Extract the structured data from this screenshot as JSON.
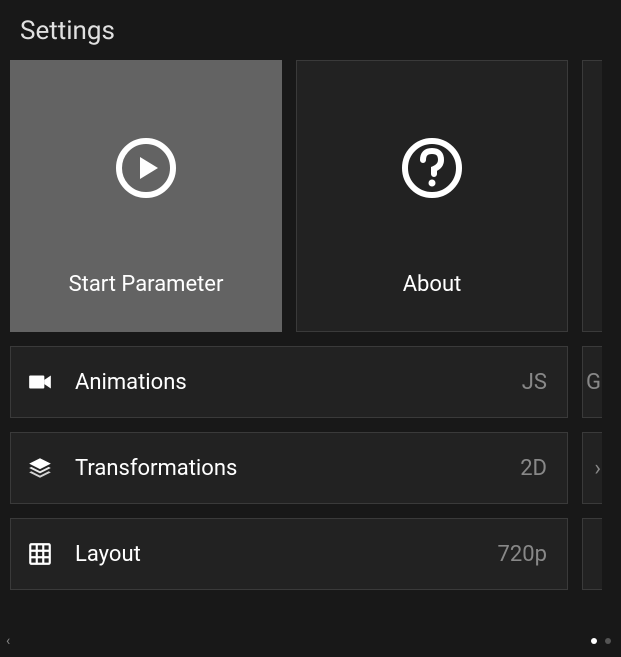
{
  "header": {
    "title": "Settings"
  },
  "cards": [
    {
      "label": "Start Parameter",
      "icon": "play-circle",
      "active": true
    },
    {
      "label": "About",
      "icon": "help-circle",
      "active": false
    }
  ],
  "rows": [
    {
      "label": "Animations",
      "value": "JS",
      "icon": "camera",
      "peek": "G"
    },
    {
      "label": "Transformations",
      "value": "2D",
      "icon": "layers",
      "peek": "›"
    },
    {
      "label": "Layout",
      "value": "720p",
      "icon": "grid",
      "peek": ""
    }
  ],
  "footer": {
    "back_arrow": "‹",
    "page_count": 2,
    "active_page": 0
  }
}
